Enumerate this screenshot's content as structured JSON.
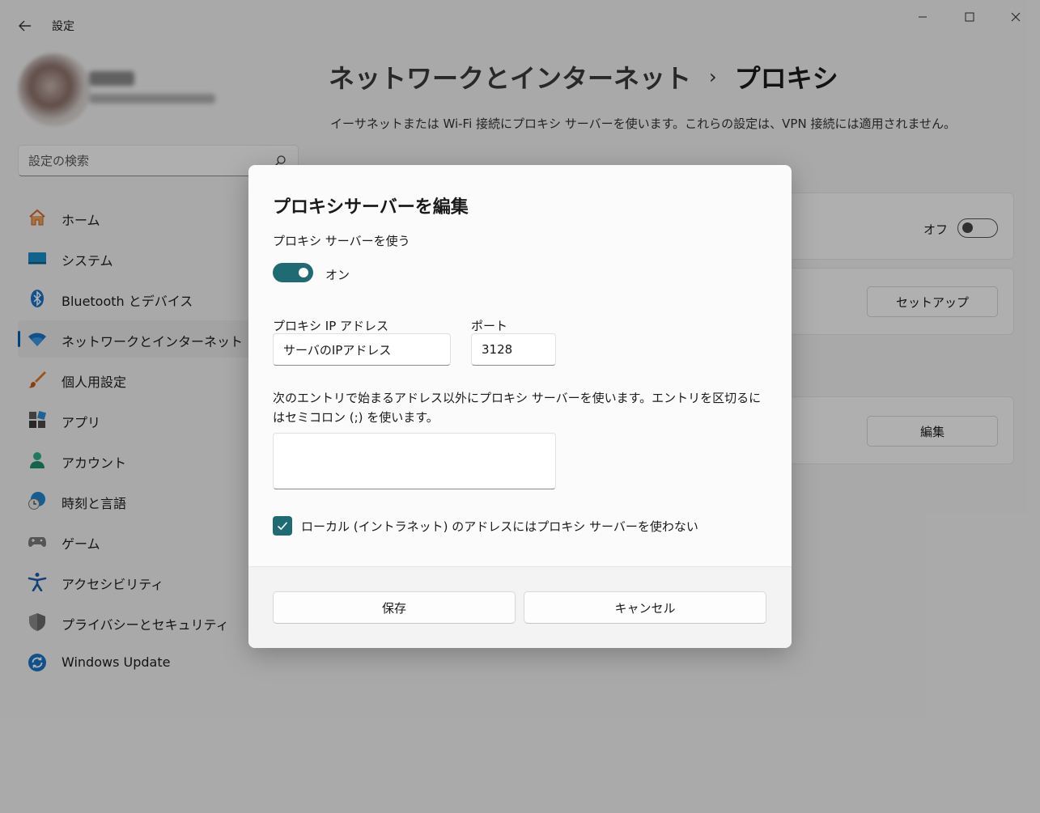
{
  "window": {
    "title": "設定"
  },
  "search": {
    "placeholder": "設定の検索"
  },
  "sidebar": {
    "items": [
      {
        "label": "ホーム",
        "icon": "home-icon"
      },
      {
        "label": "システム",
        "icon": "system-icon"
      },
      {
        "label": "Bluetooth とデバイス",
        "icon": "bluetooth-icon"
      },
      {
        "label": "ネットワークとインターネット",
        "icon": "wifi-icon",
        "active": true
      },
      {
        "label": "個人用設定",
        "icon": "brush-icon"
      },
      {
        "label": "アプリ",
        "icon": "apps-icon"
      },
      {
        "label": "アカウント",
        "icon": "account-icon"
      },
      {
        "label": "時刻と言語",
        "icon": "time-language-icon"
      },
      {
        "label": "ゲーム",
        "icon": "gamepad-icon"
      },
      {
        "label": "アクセシビリティ",
        "icon": "accessibility-icon"
      },
      {
        "label": "プライバシーとセキュリティ",
        "icon": "shield-icon"
      },
      {
        "label": "Windows Update",
        "icon": "windows-update-icon"
      }
    ]
  },
  "header": {
    "breadcrumb_parent": "ネットワークとインターネット",
    "breadcrumb_separator": "›",
    "title": "プロキシ",
    "description": "イーサネットまたは Wi-Fi 接続にプロキシ サーバーを使います。これらの設定は、VPN 接続には適用されません。"
  },
  "background_cards": {
    "auto_detect_state": "オフ",
    "setup_button": "セットアップ",
    "edit_button": "編集"
  },
  "dialog": {
    "title": "プロキシサーバーを編集",
    "use_proxy_label": "プロキシ サーバーを使う",
    "toggle_state": "オン",
    "ip_label": "プロキシ IP アドレス",
    "ip_value": "サーバのIPアドレス",
    "port_label": "ポート",
    "port_value": "3128",
    "exceptions_label": "次のエントリで始まるアドレス以外にプロキシ サーバーを使います。エントリを区切るにはセミコロン (;) を使います。",
    "exceptions_value": "",
    "local_bypass_label": "ローカル (イントラネット) のアドレスにはプロキシ サーバーを使わない",
    "local_bypass_checked": true,
    "save_button": "保存",
    "cancel_button": "キャンセル"
  },
  "colors": {
    "accent": "#1f6b73",
    "nav_indicator": "#005fb8"
  }
}
